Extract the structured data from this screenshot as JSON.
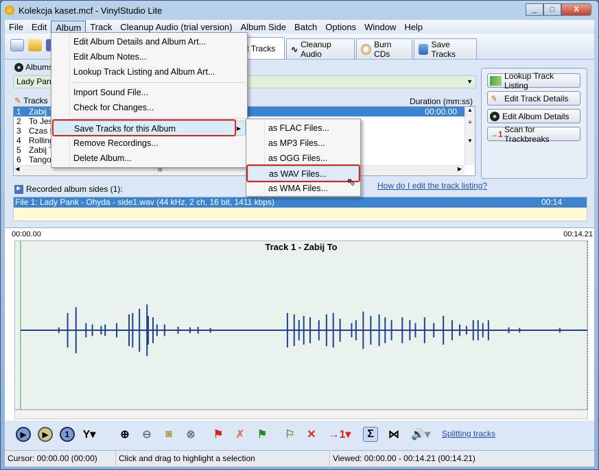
{
  "window": {
    "title": "Kolekcja kaset.mcf - VinylStudio Lite",
    "controls": [
      "_",
      "□",
      "X"
    ]
  },
  "menubar": [
    "File",
    "Edit",
    "Album",
    "Track",
    "Cleanup Audio (trial version)",
    "Album Side",
    "Batch",
    "Options",
    "Window",
    "Help"
  ],
  "album_menu": {
    "items": [
      "Edit Album Details and Album Art...",
      "Edit Album Notes...",
      "Lookup Track Listing and Album Art...",
      "Import Sound File...",
      "Check for Changes...",
      "Save Tracks for this Album",
      "Remove Recordings...",
      "Delete Album..."
    ],
    "highlighted": "Save Tracks for this Album"
  },
  "save_submenu": {
    "items": [
      "as FLAC Files...",
      "as MP3 Files...",
      "as OGG Files...",
      "as WAV Files...",
      "as WMA Files..."
    ],
    "highlighted": "as WAV Files..."
  },
  "tabs": [
    "lit Tracks",
    "Cleanup Audio",
    "Burn CDs",
    "Save Tracks"
  ],
  "albums": {
    "label": "Albums",
    "selected": "Lady Pank"
  },
  "tracks": {
    "label": "Tracks",
    "duration_header": "Duration (mm:ss)",
    "rows": [
      {
        "n": "1",
        "title": "Zabij T",
        "duration": "00:00.00"
      },
      {
        "n": "2",
        "title": "To Jes",
        "duration": ""
      },
      {
        "n": "3",
        "title": "Czas N",
        "duration": ""
      },
      {
        "n": "4",
        "title": "Rolling",
        "duration": ""
      },
      {
        "n": "5",
        "title": "Zabij T",
        "duration": ""
      },
      {
        "n": "6",
        "title": "Tango",
        "duration": ""
      }
    ]
  },
  "actions": [
    "Lookup Track Listing",
    "Edit Track Details",
    "Edit Album Details",
    "Scan for Trackbreaks"
  ],
  "help_link": "How do I edit the track listing?",
  "sides": {
    "label": "Recorded album sides (1):",
    "file": "File 1: Lady Pank - Ohyda - side1.wav (44 kHz, 2 ch, 16 bit, 1411 kbps)",
    "duration": "00:14"
  },
  "waveform": {
    "start_label": "00:00.00",
    "end_label": "00:14.21",
    "track_title": "Track 1 - Zabij To",
    "duration_s": 14.21,
    "color": "#1f3f8f",
    "spikes": [
      [
        0.96,
        0.1
      ],
      [
        1.18,
        0.6
      ],
      [
        1.39,
        0.8
      ],
      [
        1.64,
        0.25
      ],
      [
        1.8,
        0.2
      ],
      [
        2.02,
        0.15
      ],
      [
        2.12,
        0.2
      ],
      [
        2.41,
        0.25
      ],
      [
        2.72,
        0.55
      ],
      [
        2.81,
        0.6
      ],
      [
        2.98,
        0.75
      ],
      [
        3.17,
        0.9
      ],
      [
        3.2,
        0.5
      ],
      [
        3.32,
        0.45
      ],
      [
        3.42,
        0.2
      ],
      [
        3.61,
        0.2
      ],
      [
        3.95,
        0.12
      ],
      [
        4.25,
        0.1
      ],
      [
        4.45,
        0.12
      ],
      [
        4.76,
        0.08
      ],
      [
        6.69,
        0.6
      ],
      [
        6.86,
        0.55
      ],
      [
        6.98,
        0.35
      ],
      [
        7.1,
        0.5
      ],
      [
        7.26,
        0.45
      ],
      [
        7.48,
        0.35
      ],
      [
        7.67,
        0.55
      ],
      [
        7.84,
        0.6
      ],
      [
        8.01,
        0.4
      ],
      [
        8.3,
        0.25
      ],
      [
        8.41,
        0.35
      ],
      [
        8.59,
        0.65
      ],
      [
        8.78,
        0.5
      ],
      [
        8.99,
        0.55
      ],
      [
        9.14,
        0.45
      ],
      [
        9.3,
        0.35
      ],
      [
        9.57,
        0.45
      ],
      [
        9.76,
        0.35
      ],
      [
        9.9,
        0.25
      ],
      [
        10.13,
        0.45
      ],
      [
        10.36,
        0.25
      ],
      [
        10.6,
        0.5
      ],
      [
        10.82,
        0.35
      ],
      [
        11.01,
        0.2
      ],
      [
        11.18,
        0.15
      ],
      [
        11.35,
        0.35
      ],
      [
        11.47,
        0.35
      ],
      [
        11.59,
        0.25
      ],
      [
        11.73,
        0.35
      ],
      [
        12.24,
        0.1
      ],
      [
        12.51,
        0.08
      ],
      [
        13.52,
        0.08
      ]
    ]
  },
  "bottom_link": "Splitting tracks",
  "status": {
    "cursor": "Cursor: 00:00.00 (00:00)",
    "hint": "Click and drag to highlight a selection",
    "viewed": "Viewed: 00:00.00 - 00:14.21 (00:14.21)"
  }
}
